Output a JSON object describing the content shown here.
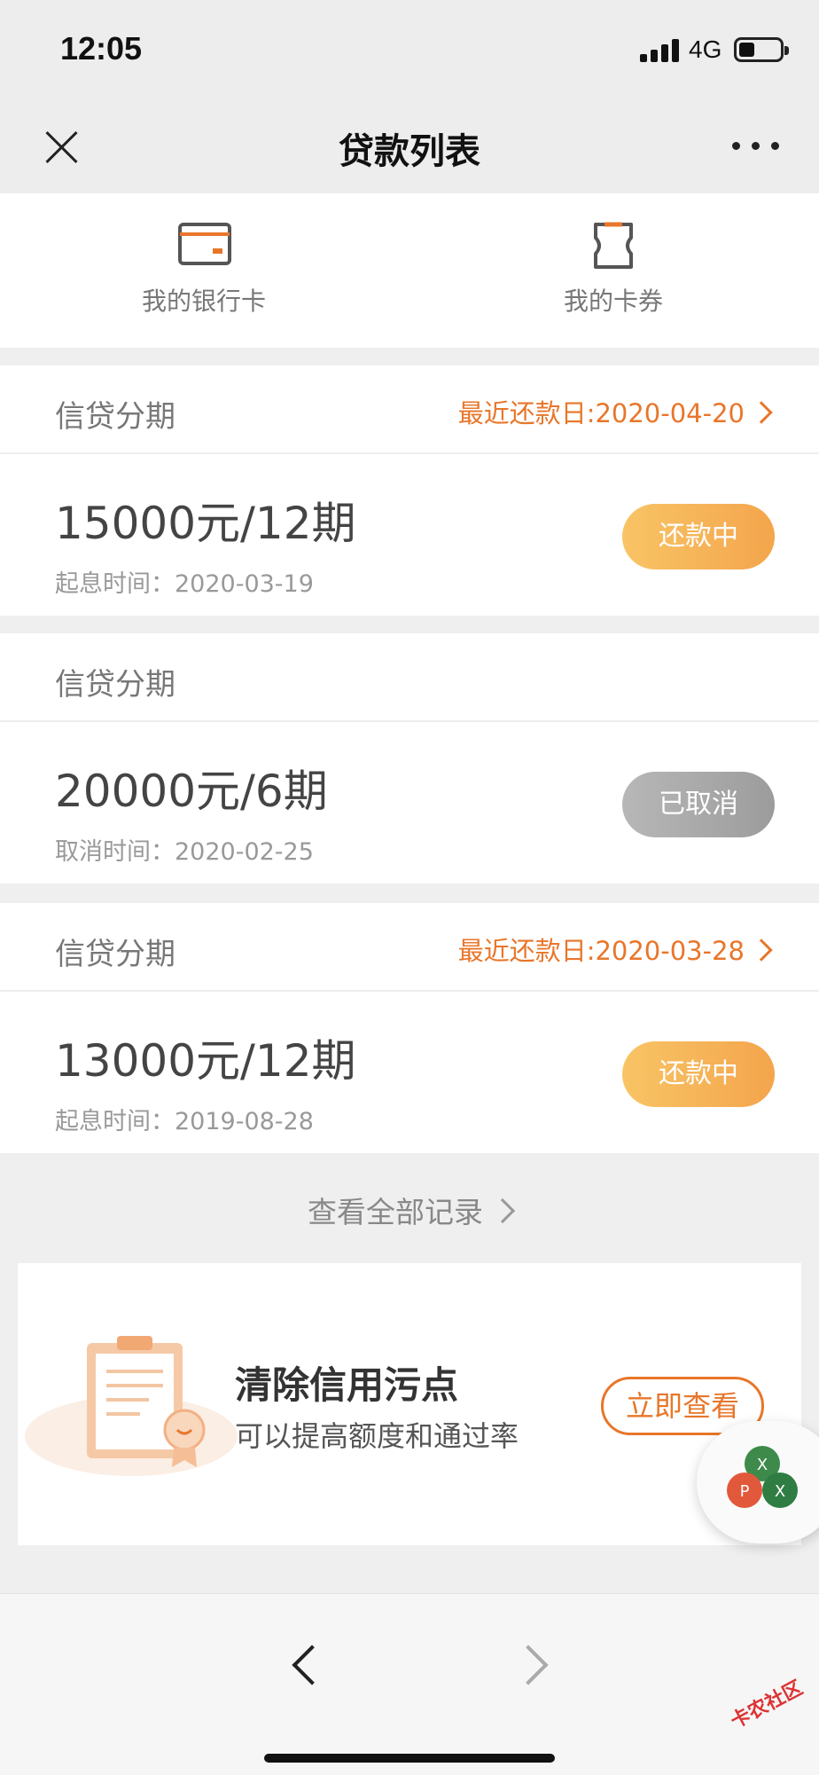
{
  "status_bar": {
    "time": "12:05",
    "network": "4G"
  },
  "nav": {
    "title": "贷款列表"
  },
  "quick_links": [
    {
      "label": "我的银行卡",
      "icon": "bank-card-icon"
    },
    {
      "label": "我的卡券",
      "icon": "coupon-icon"
    }
  ],
  "loans": [
    {
      "type": "信贷分期",
      "due": "最近还款日:2020-04-20",
      "amount": "15000元/12期",
      "subline": "起息时间：2020-03-19",
      "status": "还款中"
    },
    {
      "type": "信贷分期",
      "due": "",
      "amount": "20000元/6期",
      "subline": "取消时间：2020-02-25",
      "status": "已取消"
    },
    {
      "type": "信贷分期",
      "due": "最近还款日:2020-03-28",
      "amount": "13000元/12期",
      "subline": "起息时间：2019-08-28",
      "status": "还款中"
    }
  ],
  "view_all": "查看全部记录",
  "banner": {
    "title": "清除信用污点",
    "subtitle": "可以提高额度和通过率",
    "button": "立即查看"
  },
  "fab": {
    "letters": [
      "X",
      "P",
      "X"
    ]
  },
  "watermark": "卡农社区",
  "colors": {
    "accent": "#e8762a",
    "pill_active": "#f4a54c",
    "pill_cancelled": "#a8a8a8"
  }
}
